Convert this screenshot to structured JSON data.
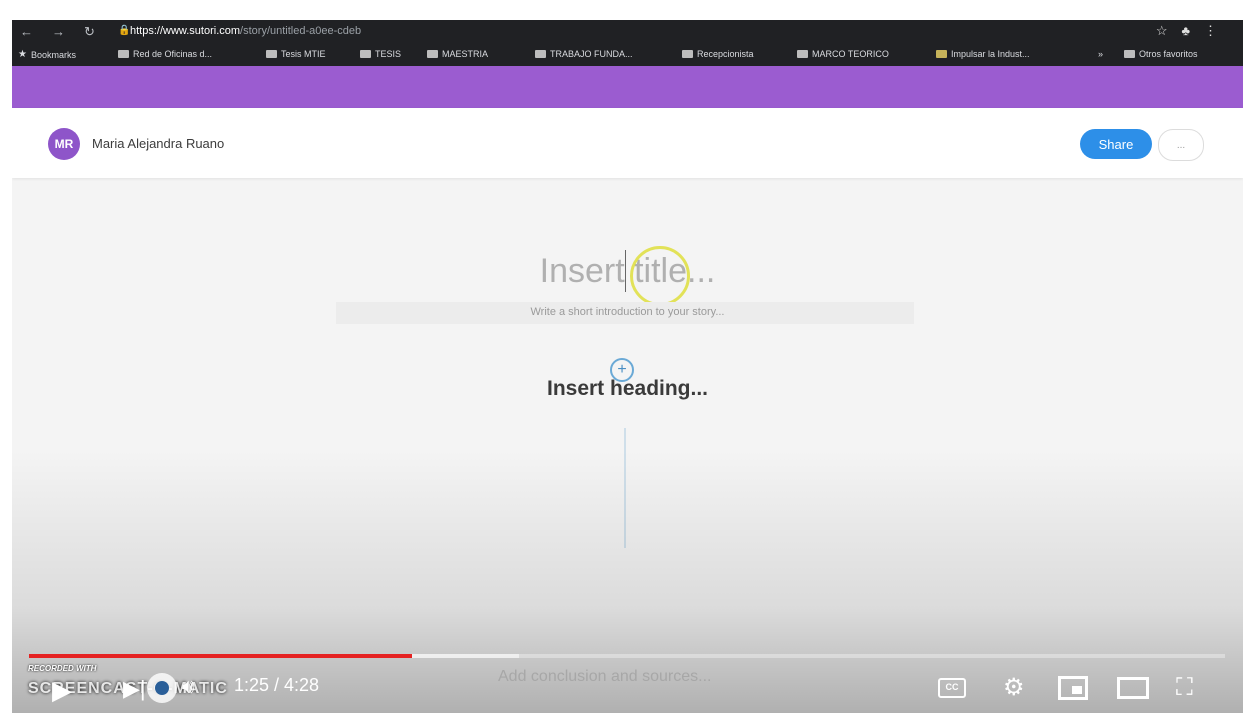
{
  "browser": {
    "url_host": "https://www.sutori.com",
    "url_path": "/story/untitled-a0ee-cdeb",
    "bookmarks": [
      {
        "label": "Bookmarks",
        "type": "star"
      },
      {
        "label": "Red de Oficinas d...",
        "type": "folder"
      },
      {
        "label": "Tesis MTIE",
        "type": "folder"
      },
      {
        "label": "TESIS",
        "type": "folder"
      },
      {
        "label": "MAESTRIA",
        "type": "folder"
      },
      {
        "label": "TRABAJO FUNDA...",
        "type": "folder"
      },
      {
        "label": "Recepcionista",
        "type": "folder"
      },
      {
        "label": "MARCO TEORICO",
        "type": "folder"
      },
      {
        "label": "Impulsar la Indust...",
        "type": "image"
      },
      {
        "label": "Otros favoritos",
        "type": "folder"
      }
    ]
  },
  "header": {
    "avatar_initials": "MR",
    "user_name": "Maria Alejandra Ruano",
    "share_label": "Share",
    "more_label": "..."
  },
  "editor": {
    "title_placeholder": "Insert title...",
    "intro_placeholder": "Write a short introduction to your story...",
    "add_symbol": "+",
    "heading_placeholder": "Insert heading...",
    "conclusion_placeholder": "Add conclusion and sources..."
  },
  "player": {
    "current_time": "1:25",
    "duration": "4:28",
    "time_display": "1:25 / 4:28",
    "played_fraction": 0.32,
    "buffered_fraction": 0.41,
    "cc_label": "CC",
    "watermark_top": "RECORDED WITH",
    "watermark_main": "SCREENCAST-O-MATIC"
  },
  "colors": {
    "accent_purple": "#9b5cd0",
    "avatar_purple": "#8e55c9",
    "share_blue": "#2d8fe8",
    "progress_red": "#e52222"
  }
}
